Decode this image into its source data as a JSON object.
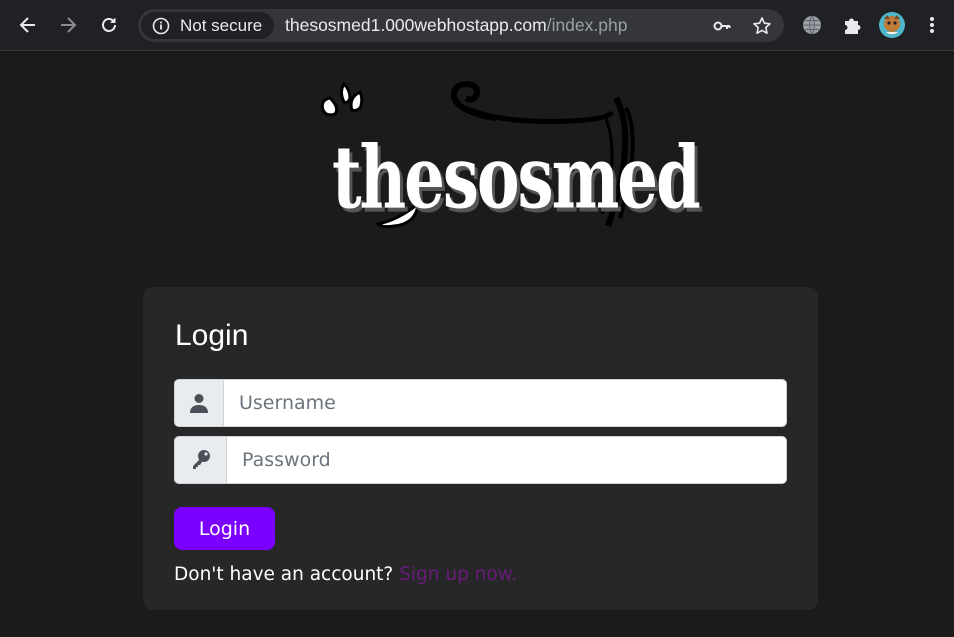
{
  "browser": {
    "security_label": "Not secure",
    "url_host": "thesosmed1.000webhostapp.com",
    "url_path": "/index.php",
    "icons": [
      "back-arrow-icon",
      "forward-arrow-icon",
      "reload-icon",
      "info-icon",
      "key-icon",
      "star-icon",
      "globe-icon",
      "puzzle-icon",
      "profile-avatar"
    ]
  },
  "site": {
    "logo_text": "thesosmed"
  },
  "login": {
    "title": "Login",
    "username_placeholder": "Username",
    "password_placeholder": "Password",
    "button_label": "Login",
    "signup_prompt": "Don't have an account?",
    "signup_link": "Sign up now.",
    "colors": {
      "button": "#7b00ff",
      "link": "#6a1b7a",
      "card": "#272727"
    }
  }
}
